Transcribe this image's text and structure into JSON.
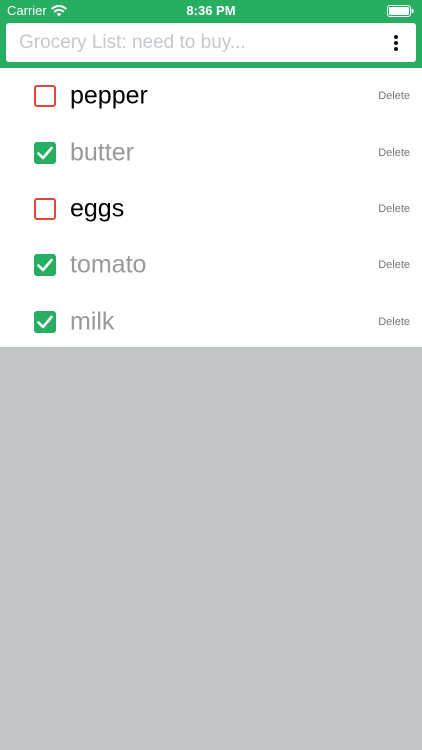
{
  "status_bar": {
    "carrier": "Carrier",
    "wifi_icon": "wifi-icon",
    "time": "8:36 PM",
    "battery_icon": "battery-full-icon"
  },
  "header": {
    "search_placeholder": "Grocery List: need to buy...",
    "search_value": "",
    "more_icon": "more-vertical-icon",
    "accent_color": "#27ae60"
  },
  "colors": {
    "checked": "#27ae60",
    "unchecked_border": "#e0463a",
    "done_text": "#999999",
    "pending_text": "#000000",
    "background": "#c2c6c7"
  },
  "items": [
    {
      "label": "pepper",
      "checked": false,
      "delete_label": "Delete"
    },
    {
      "label": "butter",
      "checked": true,
      "delete_label": "Delete"
    },
    {
      "label": "eggs",
      "checked": false,
      "delete_label": "Delete"
    },
    {
      "label": "tomato",
      "checked": true,
      "delete_label": "Delete"
    },
    {
      "label": "milk",
      "checked": true,
      "delete_label": "Delete"
    }
  ]
}
